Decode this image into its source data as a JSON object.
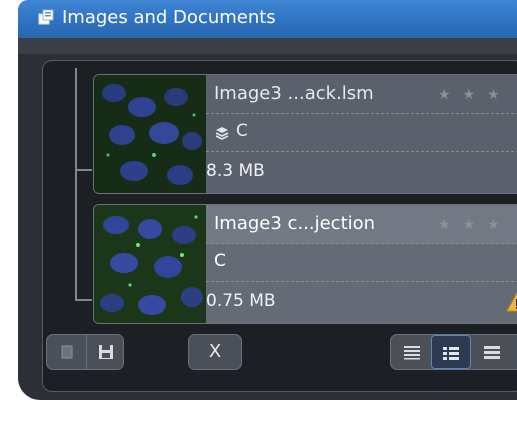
{
  "window": {
    "title": "Images and Documents",
    "icon": "documents-icon",
    "title_bar_color": "#2f73c2"
  },
  "documents": [
    {
      "name": "Image3 ...ack.lsm",
      "channel": "C",
      "size": "8.3 MB",
      "rating_stars": "★★★",
      "has_stack_icon": true,
      "selected": false
    },
    {
      "name": "Image3 c...jection",
      "channel": "C",
      "size": "0.75 MB",
      "rating_stars": "★★★",
      "has_warning_icon": true,
      "selected": true
    }
  ],
  "toolbar": {
    "new_icon": "new-document-icon",
    "save_icon": "save-icon",
    "close_label": "X",
    "view_icons": [
      "list-view-icon",
      "detail-view-icon",
      "grid-view-icon"
    ]
  }
}
